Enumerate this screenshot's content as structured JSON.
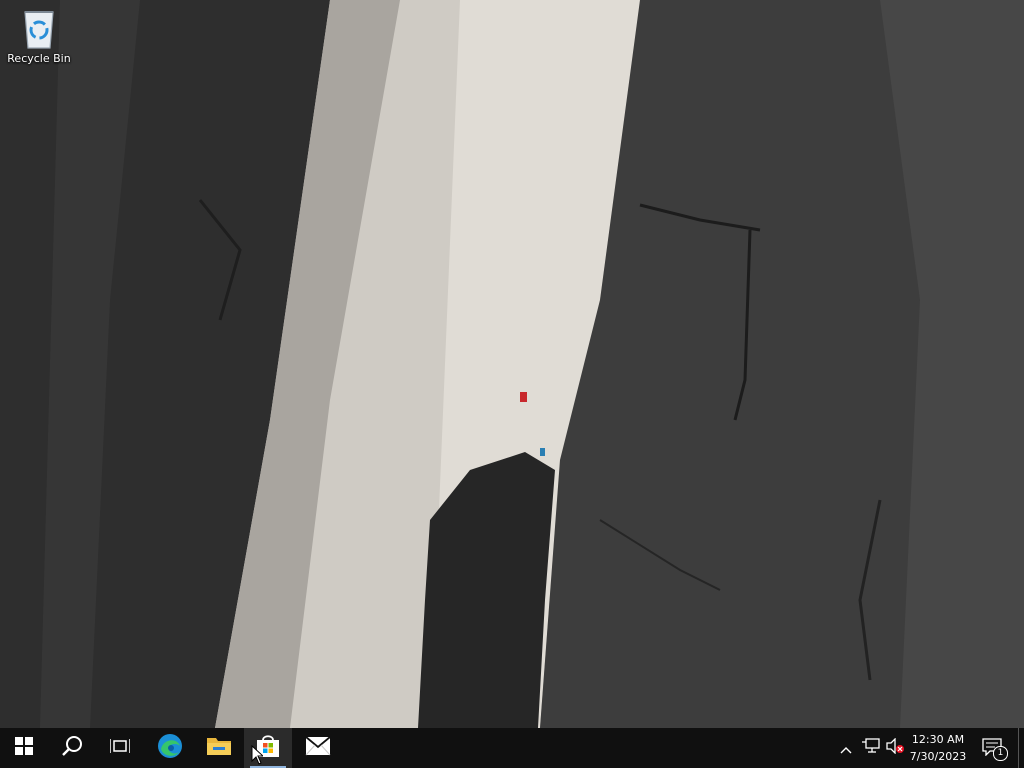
{
  "desktop": {
    "icons": [
      {
        "label": "Recycle Bin",
        "icon": "recycle-bin-icon"
      }
    ]
  },
  "taskbar": {
    "start": {
      "icon": "windows-logo-icon"
    },
    "search": {
      "icon": "search-icon"
    },
    "task_view": {
      "icon": "task-view-icon"
    },
    "pinned_apps": [
      {
        "name": "Microsoft Edge",
        "icon": "edge-icon"
      },
      {
        "name": "File Explorer",
        "icon": "folder-icon"
      },
      {
        "name": "Microsoft Store",
        "icon": "store-icon"
      },
      {
        "name": "Mail",
        "icon": "mail-icon"
      }
    ],
    "tray": {
      "overflow_icon": "chevron-up-icon",
      "network_icon": "network-icon",
      "volume_icon": "volume-muted-icon",
      "time": "12:30 AM",
      "date": "7/30/2023",
      "notifications_count": "1"
    }
  },
  "colors": {
    "taskbar_bg": "#101010",
    "accent": "#0078d7"
  }
}
